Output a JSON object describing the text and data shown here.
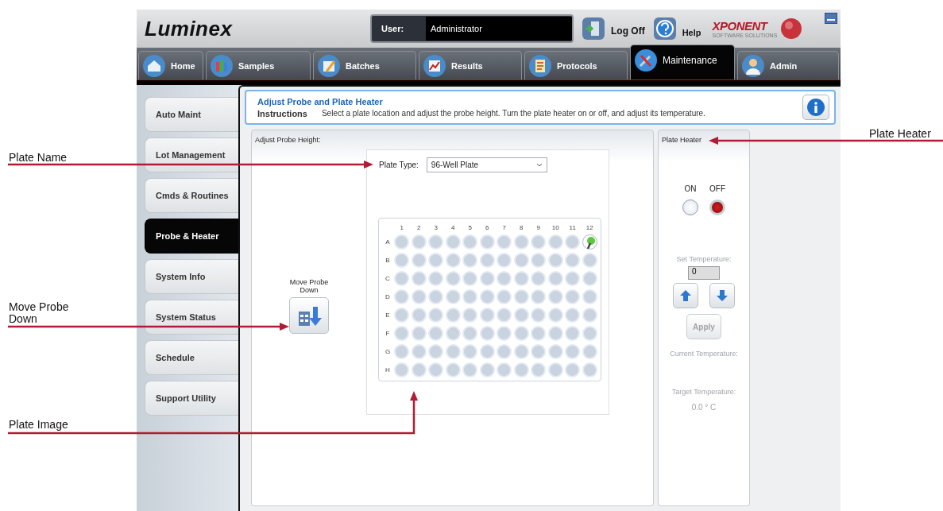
{
  "header": {
    "logo": "Luminex",
    "user_label": "User:",
    "user": "Administrator",
    "log_off": "Log Off",
    "help": "Help",
    "brand": "XPONENT",
    "brand_sub": "SOFTWARE SOLUTIONS"
  },
  "tabs": [
    {
      "label": "Home",
      "selected": false
    },
    {
      "label": "Samples",
      "selected": false
    },
    {
      "label": "Batches",
      "selected": false
    },
    {
      "label": "Results",
      "selected": false
    },
    {
      "label": "Protocols",
      "selected": false
    },
    {
      "label": "Maintenance",
      "selected": true
    },
    {
      "label": "Admin",
      "selected": false
    }
  ],
  "sidebar": {
    "items": [
      {
        "label": "Auto Maint",
        "selected": false
      },
      {
        "label": "Lot Management",
        "selected": false
      },
      {
        "label": "Cmds & Routines",
        "selected": false
      },
      {
        "label": "Probe & Heater",
        "selected": true
      },
      {
        "label": "System Info",
        "selected": false
      },
      {
        "label": "System Status",
        "selected": false
      },
      {
        "label": "Schedule",
        "selected": false
      },
      {
        "label": "Support Utility",
        "selected": false
      }
    ]
  },
  "page": {
    "title": "Adjust Probe and Plate Heater",
    "instructions_label": "Instructions",
    "instructions": "Select a plate location and adjust the probe height. Turn the plate heater on or off, and adjust its temperature."
  },
  "probe": {
    "title": "Adjust Probe Height:",
    "plate_type_label": "Plate Type:",
    "plate_type": "96-Well Plate",
    "move_label": "Move Probe Down",
    "plate": {
      "columns": [
        "1",
        "2",
        "3",
        "4",
        "5",
        "6",
        "7",
        "8",
        "9",
        "10",
        "11",
        "12"
      ],
      "rows": [
        {
          "label": "A",
          "wells": [
            false,
            false,
            false,
            false,
            false,
            false,
            false,
            false,
            false,
            false,
            false,
            true
          ]
        },
        {
          "label": "B",
          "wells": [
            false,
            false,
            false,
            false,
            false,
            false,
            false,
            false,
            false,
            false,
            false,
            false
          ]
        },
        {
          "label": "C",
          "wells": [
            false,
            false,
            false,
            false,
            false,
            false,
            false,
            false,
            false,
            false,
            false,
            false
          ]
        },
        {
          "label": "D",
          "wells": [
            false,
            false,
            false,
            false,
            false,
            false,
            false,
            false,
            false,
            false,
            false,
            false
          ]
        },
        {
          "label": "E",
          "wells": [
            false,
            false,
            false,
            false,
            false,
            false,
            false,
            false,
            false,
            false,
            false,
            false
          ]
        },
        {
          "label": "F",
          "wells": [
            false,
            false,
            false,
            false,
            false,
            false,
            false,
            false,
            false,
            false,
            false,
            false
          ]
        },
        {
          "label": "G",
          "wells": [
            false,
            false,
            false,
            false,
            false,
            false,
            false,
            false,
            false,
            false,
            false,
            false
          ]
        },
        {
          "label": "H",
          "wells": [
            false,
            false,
            false,
            false,
            false,
            false,
            false,
            false,
            false,
            false,
            false,
            false
          ]
        }
      ]
    }
  },
  "heater": {
    "title": "Plate Heater",
    "switches": [
      {
        "label": "ON",
        "selected": false
      },
      {
        "label": "OFF",
        "selected": true
      }
    ],
    "set_label": "Set Temperature:",
    "set_value": "0",
    "disabled": true,
    "apply": "Apply",
    "current_label": "Current Temperature:",
    "target_label": "Target Temperature:",
    "target_value": "0.0 ° C"
  },
  "annotations": [
    {
      "label": "Plate Heater"
    },
    {
      "label": "Plate Name"
    },
    {
      "label": "Move Probe Down"
    },
    {
      "label": "Plate Image"
    }
  ]
}
